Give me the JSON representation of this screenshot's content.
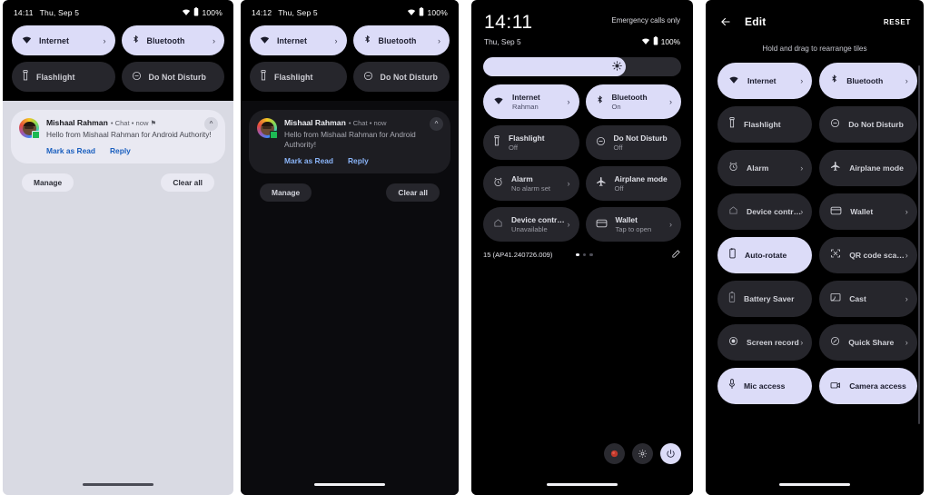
{
  "panel1": {
    "name": "notification-shade-light",
    "status_bar": {
      "time": "14:11",
      "date": "Thu, Sep 5",
      "battery": "100%",
      "wifi_icon": "wifi-icon",
      "battery_icon": "battery-icon"
    },
    "tiles": [
      {
        "label": "Internet",
        "icon": "wifi-icon",
        "state": "on",
        "chevron": "›"
      },
      {
        "label": "Bluetooth",
        "icon": "bluetooth-icon",
        "state": "on",
        "chevron": "›"
      },
      {
        "label": "Flashlight",
        "icon": "flashlight-icon",
        "state": "off",
        "chevron": ""
      },
      {
        "label": "Do Not Disturb",
        "icon": "do-not-disturb-icon",
        "state": "off",
        "chevron": ""
      }
    ],
    "notification": {
      "sender": "Mishaal Rahman",
      "meta": "• Chat • now ⚑",
      "body": "Hello from Mishaal Rahman for Android Authority!",
      "action_1": "Mark as Read",
      "action_2": "Reply",
      "collapse_icon": "chevron-up-icon"
    },
    "footer": {
      "manage": "Manage",
      "clear_all": "Clear all"
    }
  },
  "panel2": {
    "name": "notification-shade-dark",
    "status_bar": {
      "time": "14:12",
      "date": "Thu, Sep 5",
      "battery": "100%",
      "wifi_icon": "wifi-icon",
      "battery_icon": "battery-icon"
    },
    "tiles": [
      {
        "label": "Internet",
        "icon": "wifi-icon",
        "state": "on",
        "chevron": "›"
      },
      {
        "label": "Bluetooth",
        "icon": "bluetooth-icon",
        "state": "on",
        "chevron": "›"
      },
      {
        "label": "Flashlight",
        "icon": "flashlight-icon",
        "state": "off",
        "chevron": ""
      },
      {
        "label": "Do Not Disturb",
        "icon": "do-not-disturb-icon",
        "state": "off",
        "chevron": ""
      }
    ],
    "notification": {
      "sender": "Mishaal Rahman",
      "meta": "• Chat • now",
      "body": "Hello from Mishaal Rahman for Android Authority!",
      "action_1": "Mark as Read",
      "action_2": "Reply",
      "collapse_icon": "chevron-up-icon"
    },
    "footer": {
      "manage": "Manage",
      "clear_all": "Clear all"
    }
  },
  "panel3": {
    "name": "quick-settings-expanded",
    "header": {
      "clock": "14:11",
      "date": "Thu, Sep 5",
      "carrier": "Emergency calls only",
      "battery": "100%"
    },
    "brightness": {
      "label": "brightness-slider",
      "value_percent": 72
    },
    "tiles": [
      {
        "label": "Internet",
        "sub": "Rahman",
        "icon": "wifi-icon",
        "state": "on",
        "chevron": "›"
      },
      {
        "label": "Bluetooth",
        "sub": "On",
        "icon": "bluetooth-icon",
        "state": "on",
        "chevron": "›"
      },
      {
        "label": "Flashlight",
        "sub": "Off",
        "icon": "flashlight-icon",
        "state": "off",
        "chevron": ""
      },
      {
        "label": "Do Not Disturb",
        "sub": "Off",
        "icon": "do-not-disturb-icon",
        "state": "off",
        "chevron": ""
      },
      {
        "label": "Alarm",
        "sub": "No alarm set",
        "icon": "alarm-icon",
        "state": "off",
        "chevron": "›"
      },
      {
        "label": "Airplane mode",
        "sub": "Off",
        "icon": "airplane-icon",
        "state": "off",
        "chevron": ""
      },
      {
        "label": "Device contr…",
        "sub": "Unavailable",
        "icon": "home-icon",
        "state": "off",
        "chevron": "›"
      },
      {
        "label": "Wallet",
        "sub": "Tap to open",
        "icon": "wallet-icon",
        "state": "off",
        "chevron": "›"
      }
    ],
    "footer": {
      "build": "15 (AP41.240726.009)",
      "page_dots": 3,
      "active_dot": 1,
      "edit_icon": "pencil-icon"
    },
    "bottom_buttons": [
      {
        "name": "screen-record-button",
        "icon": "record-icon",
        "style": "dark"
      },
      {
        "name": "settings-button",
        "icon": "gear-icon",
        "style": "dark"
      },
      {
        "name": "power-button",
        "icon": "power-icon",
        "style": "light"
      }
    ]
  },
  "panel4": {
    "name": "edit-tiles-screen",
    "header": {
      "back_icon": "arrow-left-icon",
      "title": "Edit",
      "reset": "RESET"
    },
    "hint": "Hold and drag to rearrange tiles",
    "tiles": [
      {
        "label": "Internet",
        "icon": "wifi-icon",
        "state": "on",
        "chevron": "›"
      },
      {
        "label": "Bluetooth",
        "icon": "bluetooth-icon",
        "state": "on",
        "chevron": "›"
      },
      {
        "label": "Flashlight",
        "icon": "flashlight-icon",
        "state": "off",
        "chevron": ""
      },
      {
        "label": "Do Not Disturb",
        "icon": "do-not-disturb-icon",
        "state": "off",
        "chevron": ""
      },
      {
        "label": "Alarm",
        "icon": "alarm-icon",
        "state": "off",
        "chevron": "›"
      },
      {
        "label": "Airplane mode",
        "icon": "airplane-icon",
        "state": "off",
        "chevron": ""
      },
      {
        "label": "Device contr…",
        "icon": "home-icon",
        "state": "off",
        "chevron": "›"
      },
      {
        "label": "Wallet",
        "icon": "wallet-icon",
        "state": "off",
        "chevron": "›"
      },
      {
        "label": "Auto-rotate",
        "icon": "auto-rotate-icon",
        "state": "on",
        "chevron": ""
      },
      {
        "label": "QR code sca…",
        "icon": "qr-code-icon",
        "state": "off",
        "chevron": "›"
      },
      {
        "label": "Battery Saver",
        "icon": "battery-saver-icon",
        "state": "off",
        "chevron": ""
      },
      {
        "label": "Cast",
        "icon": "cast-icon",
        "state": "off",
        "chevron": "›"
      },
      {
        "label": "Screen record",
        "icon": "record-icon",
        "state": "off",
        "chevron": "›"
      },
      {
        "label": "Quick Share",
        "icon": "quick-share-icon",
        "state": "off",
        "chevron": "›"
      },
      {
        "label": "Mic access",
        "icon": "mic-icon",
        "state": "on",
        "chevron": ""
      },
      {
        "label": "Camera access",
        "icon": "camera-icon",
        "state": "on",
        "chevron": ""
      }
    ]
  },
  "colors": {
    "accent_on": "#dcdcf8",
    "tile_off": "#26262c",
    "shade_light": "#d9dae3",
    "shade_dark": "#0b0b0e",
    "link": "#1a5fbf",
    "link_dark": "#8ab4f8"
  }
}
